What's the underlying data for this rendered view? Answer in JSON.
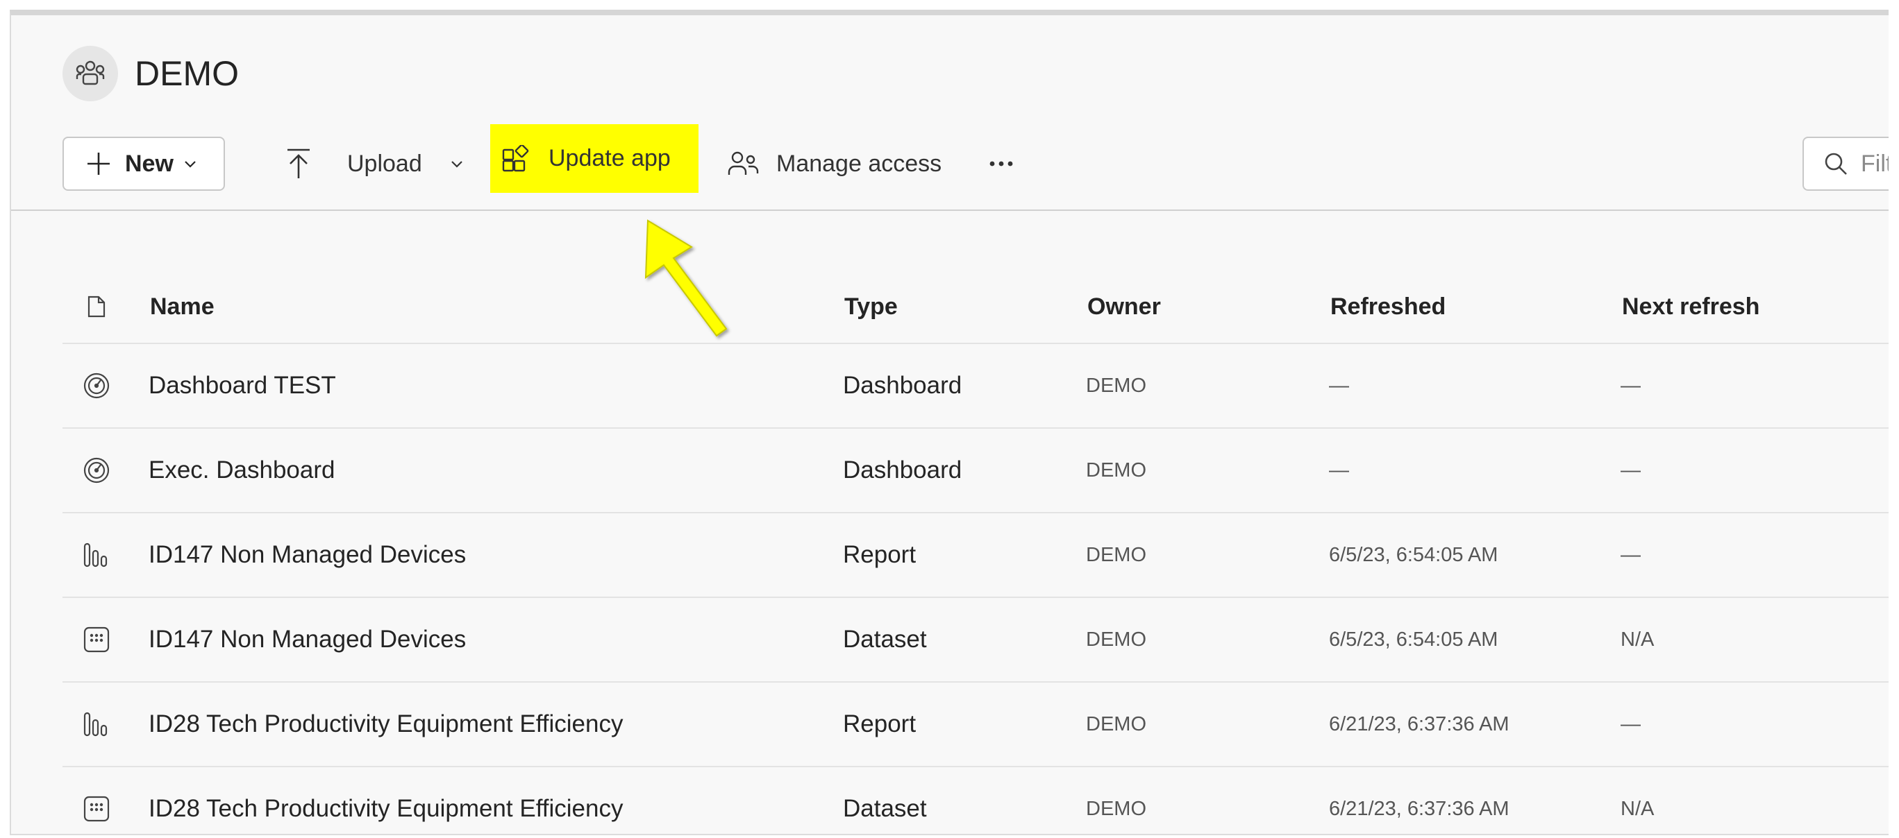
{
  "workspace": {
    "title": "DEMO",
    "avatar_icon": "group-icon"
  },
  "toolbar": {
    "new_label": "New",
    "upload_label": "Upload",
    "update_app_label": "Update app",
    "manage_access_label": "Manage access",
    "more_label": "···",
    "filter_placeholder": "Filter by keyword"
  },
  "highlight_color": "#ffff00",
  "annotation": {
    "arrow_color": "#ffff00",
    "points_to": "update-app-button"
  },
  "table": {
    "columns": [
      "Name",
      "Type",
      "Owner",
      "Refreshed",
      "Next refresh"
    ],
    "rows": [
      {
        "icon": "dashboard-icon",
        "name": "Dashboard TEST",
        "type": "Dashboard",
        "owner": "DEMO",
        "refreshed": "—",
        "next": "—"
      },
      {
        "icon": "dashboard-icon",
        "name": "Exec. Dashboard",
        "type": "Dashboard",
        "owner": "DEMO",
        "refreshed": "—",
        "next": "—"
      },
      {
        "icon": "report-icon",
        "name": "ID147 Non Managed Devices",
        "type": "Report",
        "owner": "DEMO",
        "refreshed": "6/5/23, 6:54:05 AM",
        "next": "—"
      },
      {
        "icon": "dataset-icon",
        "name": "ID147 Non Managed Devices",
        "type": "Dataset",
        "owner": "DEMO",
        "refreshed": "6/5/23, 6:54:05 AM",
        "next": "N/A"
      },
      {
        "icon": "report-icon",
        "name": "ID28 Tech Productivity Equipment Efficiency",
        "type": "Report",
        "owner": "DEMO",
        "refreshed": "6/21/23, 6:37:36 AM",
        "next": "—"
      },
      {
        "icon": "dataset-icon",
        "name": "ID28 Tech Productivity Equipment Efficiency",
        "type": "Dataset",
        "owner": "DEMO",
        "refreshed": "6/21/23, 6:37:36 AM",
        "next": "N/A"
      }
    ]
  }
}
